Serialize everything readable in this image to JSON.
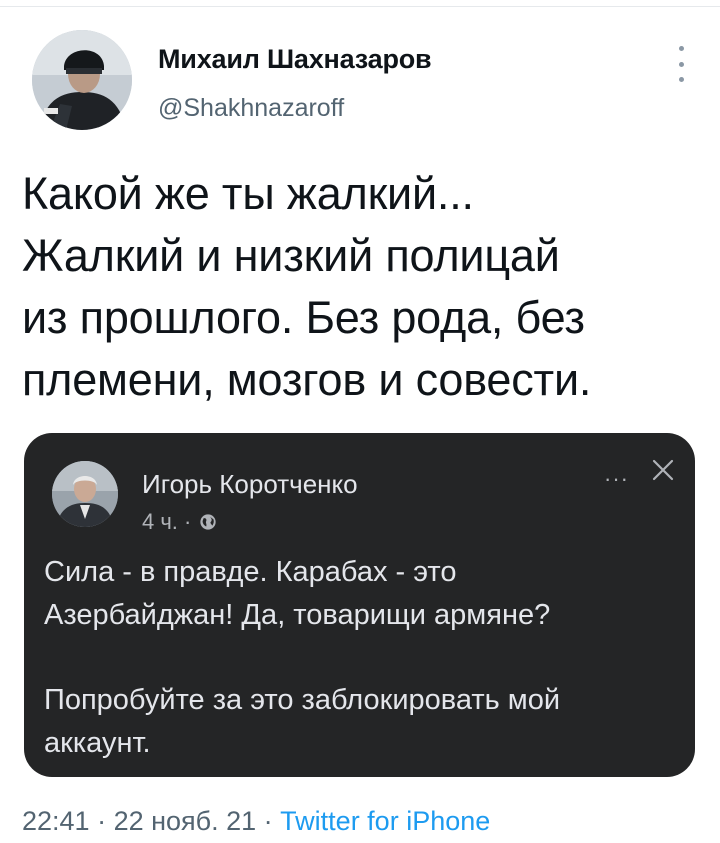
{
  "tweet": {
    "author_name": "Михаил Шахназаров",
    "author_handle": "@Shakhnazaroff",
    "text_lines": [
      "Какой же ты жалкий...",
      "Жалкий и низкий полицай",
      "из прошлого. Без рода, без",
      "племени, мозгов и совести."
    ],
    "time": "22:41",
    "separator": " · ",
    "date": "22 нояб. 21",
    "source": "Twitter for iPhone"
  },
  "quote": {
    "author_name": "Игорь Коротченко",
    "time": "4 ч. ·",
    "lines": [
      "Сила - в правде. Карабах - это",
      "Азербайджан! Да, товарищи армяне?",
      "Попробуйте за это заблокировать мой",
      "аккаунт."
    ],
    "more": "···"
  },
  "icons": {
    "more": "more-vertical-icon",
    "close": "close-icon",
    "globe": "globe-icon"
  },
  "colors": {
    "link": "#1d9bf0",
    "card_bg": "#242526",
    "secondary_text": "#536471"
  }
}
